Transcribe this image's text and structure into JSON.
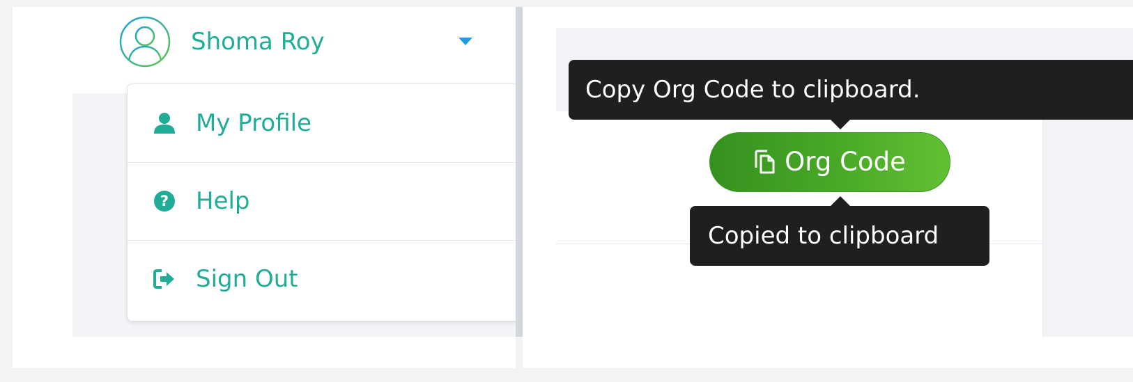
{
  "user": {
    "name": "Shoma Roy",
    "avatar_icon": "user-avatar-icon"
  },
  "menu": {
    "items": [
      {
        "label": "My Profile",
        "icon": "user-icon"
      },
      {
        "label": "Help",
        "icon": "question-circle-icon"
      },
      {
        "label": "Sign Out",
        "icon": "sign-out-icon"
      }
    ]
  },
  "org": {
    "button_label": "Org Code",
    "button_icon": "copy-icon",
    "tooltip_hint": "Copy Org Code to clipboard.",
    "tooltip_copied": "Copied to clipboard"
  },
  "colors": {
    "accent_teal": "#1fad95",
    "caret_blue": "#1e9be4",
    "button_green": "#49aa28",
    "tooltip_bg": "#1f1f1f"
  }
}
